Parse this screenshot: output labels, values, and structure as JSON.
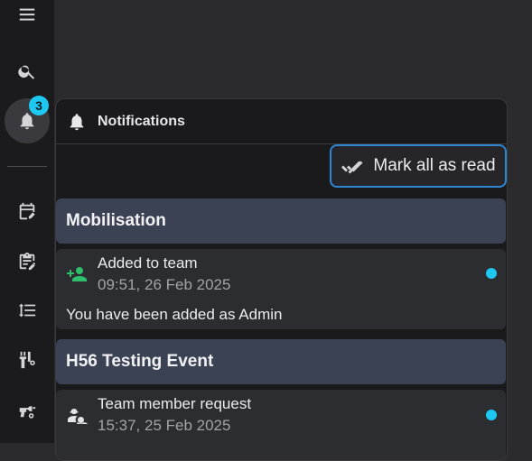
{
  "sidebar": {
    "icons": [
      "menu-icon",
      "search-icon",
      "bell-icon",
      "calendar-edit-icon",
      "clipboard-edit-icon",
      "list-order-icon",
      "tools-settings-icon",
      "drill-settings-icon"
    ],
    "unread_badge": "3"
  },
  "panel": {
    "title": "Notifications",
    "mark_all_label": "Mark all as read",
    "accent": "#2e86d3",
    "unread_dot_color": "#1ec8f0"
  },
  "groups": [
    {
      "name": "Mobilisation",
      "items": [
        {
          "icon": "add-person-icon",
          "title": "Added to team",
          "time": "09:51, 26 Feb 2025",
          "body": "You have been added as Admin",
          "unread": true
        }
      ]
    },
    {
      "name": "H56 Testing Event",
      "items": [
        {
          "icon": "worker-request-icon",
          "title": "Team member request",
          "time": "15:37, 25 Feb 2025",
          "unread": true
        }
      ]
    }
  ]
}
